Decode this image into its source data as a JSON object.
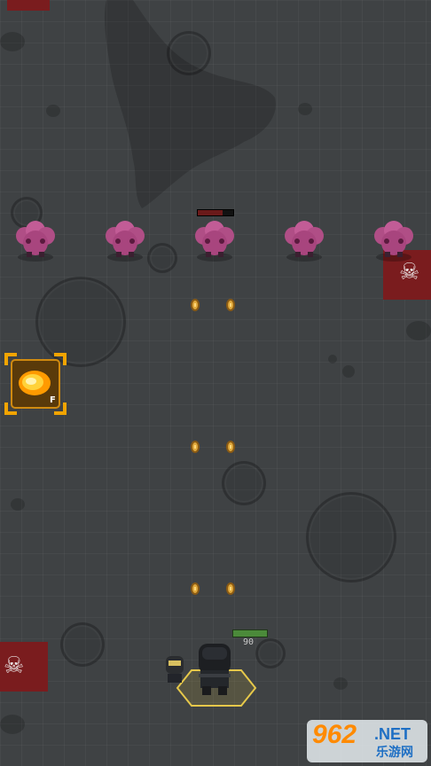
{
  "hud": {
    "skill_slot": {
      "hotkey": "F",
      "icon": "fireball-skill-icon",
      "state": "ready"
    },
    "player_health_value": "90"
  },
  "enemies": {
    "count": 5,
    "name": "pink-spore-blob",
    "targeted_index": 2
  },
  "coins": {
    "count": 6
  },
  "watermark": {
    "number": "962",
    "suffix": ".NET",
    "sub": "乐游网"
  },
  "colors": {
    "floor": "#3f4244",
    "flag": "#7a1c1e",
    "coin": "#e0a93c",
    "skill_glow": "#f2a400",
    "health_bar": "#4b8a3a",
    "enemy": "#b04e86"
  }
}
